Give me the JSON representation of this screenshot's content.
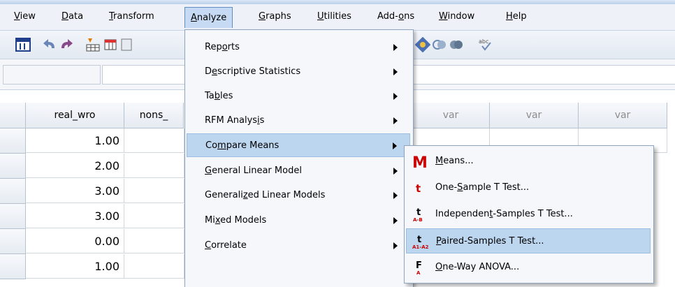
{
  "menubar": {
    "items": [
      {
        "pre": "",
        "u": "V",
        "post": "iew"
      },
      {
        "pre": "",
        "u": "D",
        "post": "ata"
      },
      {
        "pre": "",
        "u": "T",
        "post": "ransform"
      },
      {
        "pre": "",
        "u": "A",
        "post": "nalyze"
      },
      {
        "pre": "",
        "u": "G",
        "post": "raphs"
      },
      {
        "pre": "",
        "u": "U",
        "post": "tilities"
      },
      {
        "pre": "Add-",
        "u": "o",
        "post": "ns"
      },
      {
        "pre": "",
        "u": "W",
        "post": "indow"
      },
      {
        "pre": "",
        "u": "H",
        "post": "elp"
      }
    ]
  },
  "toolbar": {
    "icons": [
      "variable-view-icon",
      "undo-icon",
      "redo-icon",
      "go-to-case-icon",
      "insert-cases-icon",
      "use-sets-icon",
      "show-all-variables-icon",
      "value-labels-icon",
      "spelling-icon"
    ]
  },
  "editor": {
    "cell_ref": "",
    "cell_value": ""
  },
  "grid": {
    "columns": [
      "real_wro",
      "nons_",
      "var",
      "var",
      "var"
    ],
    "rows": [
      "1.00",
      "2.00",
      "3.00",
      "3.00",
      "0.00",
      "1.00"
    ]
  },
  "analyze_menu": {
    "items": [
      {
        "pre": "Rep",
        "u": "o",
        "post": "rts",
        "sub": true
      },
      {
        "pre": "D",
        "u": "e",
        "post": "scriptive Statistics",
        "sub": true
      },
      {
        "pre": "Ta",
        "u": "b",
        "post": "les",
        "sub": true
      },
      {
        "pre": "RFM Analys",
        "u": "i",
        "post": "s",
        "sub": true
      },
      {
        "pre": "Co",
        "u": "m",
        "post": "pare Means",
        "sub": true
      },
      {
        "pre": "",
        "u": "G",
        "post": "eneral Linear Model",
        "sub": true
      },
      {
        "pre": "Generali",
        "u": "z",
        "post": "ed Linear Models",
        "sub": true
      },
      {
        "pre": "Mi",
        "u": "x",
        "post": "ed Models",
        "sub": true
      },
      {
        "pre": "",
        "u": "C",
        "post": "orrelate",
        "sub": true
      }
    ]
  },
  "compare_means_menu": {
    "items": [
      {
        "pre": "",
        "u": "M",
        "post": "eans...",
        "icon": "means-icon"
      },
      {
        "pre": "One-",
        "u": "S",
        "post": "ample T Test...",
        "icon": "one-sample-t-icon"
      },
      {
        "pre": "Independen",
        "u": "t",
        "post": "-Samples T Test...",
        "icon": "independent-samples-t-icon"
      },
      {
        "pre": "",
        "u": "P",
        "post": "aired-Samples T Test...",
        "icon": "paired-samples-t-icon"
      },
      {
        "pre": "",
        "u": "O",
        "post": "ne-Way ANOVA...",
        "icon": "one-way-anova-icon"
      }
    ]
  },
  "colors": {
    "accent": "#5f8dc3",
    "highlight": "#bdd6f0",
    "menu_bg": "#f5f7fb",
    "icon_red": "#cc0000"
  }
}
